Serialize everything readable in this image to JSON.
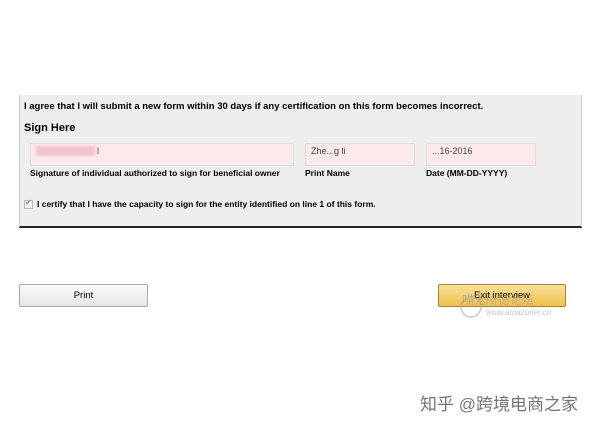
{
  "form": {
    "agree_text": "I agree that I will submit a new form within 30 days if any certification on this form becomes incorrect.",
    "sign_here": "Sign Here",
    "signature": {
      "value": "l",
      "label": "Signature of individual authorized to sign for beneficial owner"
    },
    "print_name": {
      "value": "Zhe...g li",
      "label": "Print Name"
    },
    "date": {
      "value": "...16-2016",
      "label": "Date (MM-DD-YYYY)"
    },
    "certify_text": "I certify that I have the capacity to sign for the entity identified on line 1 of this form.",
    "certify_checked": true
  },
  "buttons": {
    "print": "Print",
    "exit": "Exit interview"
  },
  "watermarks": {
    "forum": "喵无所德论坛",
    "forum_url": "www.amazoner.cn",
    "zhihu": "知乎 @跨境电商之家"
  }
}
